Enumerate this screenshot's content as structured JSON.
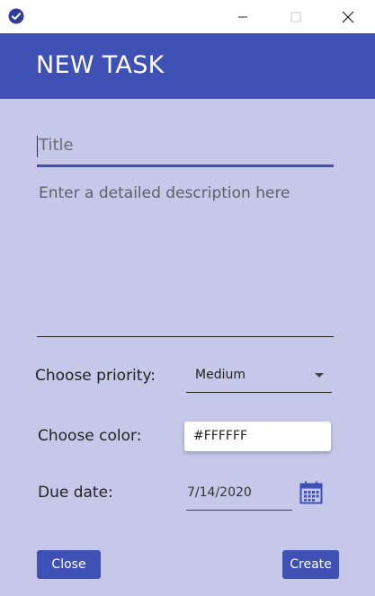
{
  "window": {
    "title": "",
    "controls": [
      "minimize",
      "maximize",
      "close"
    ]
  },
  "header": {
    "title": "NEW TASK"
  },
  "form": {
    "title_placeholder": "Title",
    "description_placeholder": "Enter a detailed description here",
    "priority_label": "Choose priority:",
    "priority_value": "Medium",
    "color_label": "Choose color:",
    "color_value": "#FFFFFF",
    "due_label": "Due date:",
    "due_value": "7/14/2020"
  },
  "buttons": {
    "close": "Close",
    "create": "Create"
  },
  "colors": {
    "accent": "#3f51b5",
    "background": "#c5c8e8"
  },
  "icons": {
    "app": "check-circle-icon",
    "calendar": "calendar-icon"
  }
}
